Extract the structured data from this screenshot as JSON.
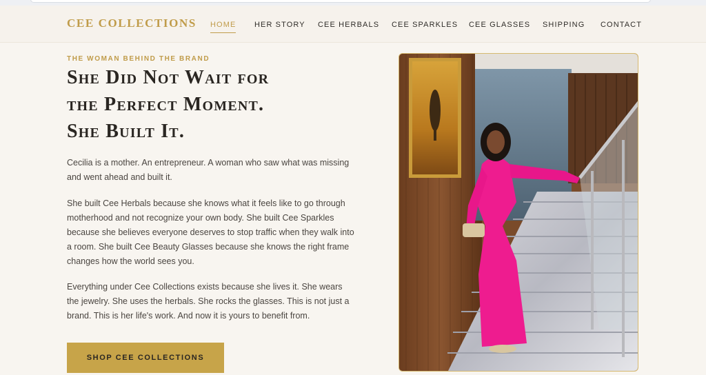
{
  "brand": {
    "logo_text": "CEE COLLECTIONS"
  },
  "nav": {
    "items": [
      {
        "label": "HOME",
        "active": true
      },
      {
        "label": "HER STORY",
        "active": false
      },
      {
        "label": "CEE HERBALS",
        "active": false
      },
      {
        "label": "CEE SPARKLES",
        "active": false
      },
      {
        "label": "CEE GLASSES",
        "active": false
      },
      {
        "label": "SHIPPING",
        "active": false
      },
      {
        "label": "CONTACT",
        "active": false
      }
    ]
  },
  "hero": {
    "eyebrow": "THE WOMAN BEHIND THE BRAND",
    "headline": {
      "line1": "She Did Not Wait for",
      "line2": "the Perfect Moment.",
      "line3": "She Built It."
    },
    "paragraphs": [
      "Cecilia is a mother. An entrepreneur. A woman who saw what was missing and went ahead and built it.",
      "She built Cee Herbals because she knows what it feels like to go through motherhood and not recognize your own body. She built Cee Sparkles because she believes everyone deserves to stop traffic when they walk into a room. She built Cee Beauty Glasses because she knows the right frame changes how the world sees you.",
      "Everything under Cee Collections exists because she lives it. She wears the jewelry. She uses the herbals. She rocks the glasses. This is not just a brand. This is her life's work. And now it is yours to benefit from."
    ],
    "cta_label": "SHOP CEE COLLECTIONS"
  },
  "colors": {
    "accent_gold": "#c09c4a",
    "background": "#f8f5f0",
    "dress_pink": "#ee1c8f"
  }
}
